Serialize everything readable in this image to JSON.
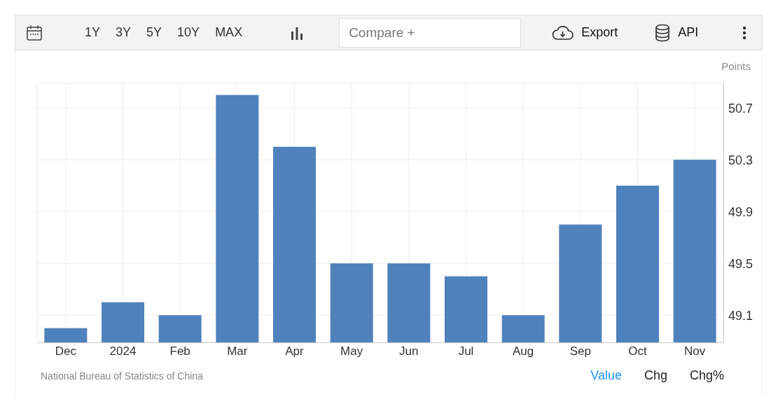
{
  "toolbar": {
    "ranges": [
      {
        "label": "1Y",
        "selected": false
      },
      {
        "label": "3Y",
        "selected": false
      },
      {
        "label": "5Y",
        "selected": false
      },
      {
        "label": "10Y",
        "selected": false
      },
      {
        "label": "MAX",
        "selected": false
      }
    ],
    "compare": {
      "placeholder": "Compare +"
    },
    "export": "Export",
    "api": "API"
  },
  "chart": {
    "chart_data": {
      "type": "bar",
      "ylabel": "Points",
      "categories": [
        "Dec",
        "2024",
        "Feb",
        "Mar",
        "Apr",
        "May",
        "Jun",
        "Jul",
        "Aug",
        "Sep",
        "Oct",
        "Nov"
      ],
      "grid": true,
      "series": [
        {
          "color": "#4f81bd",
          "values": [
            49.0,
            49.2,
            49.1,
            50.8,
            50.4,
            49.5,
            49.5,
            49.4,
            49.1,
            49.8,
            50.1,
            50.3
          ]
        }
      ],
      "ylim": [
        48.89,
        50.89
      ],
      "yticks": [
        49.1,
        49.5,
        49.9,
        50.3,
        50.7
      ]
    }
  },
  "footer": {
    "source": "National Bureau of Statistics of China",
    "views": [
      {
        "label": "Value",
        "selected": true
      },
      {
        "label": "Chg",
        "selected": false
      },
      {
        "label": "Chg%",
        "selected": false
      }
    ]
  }
}
